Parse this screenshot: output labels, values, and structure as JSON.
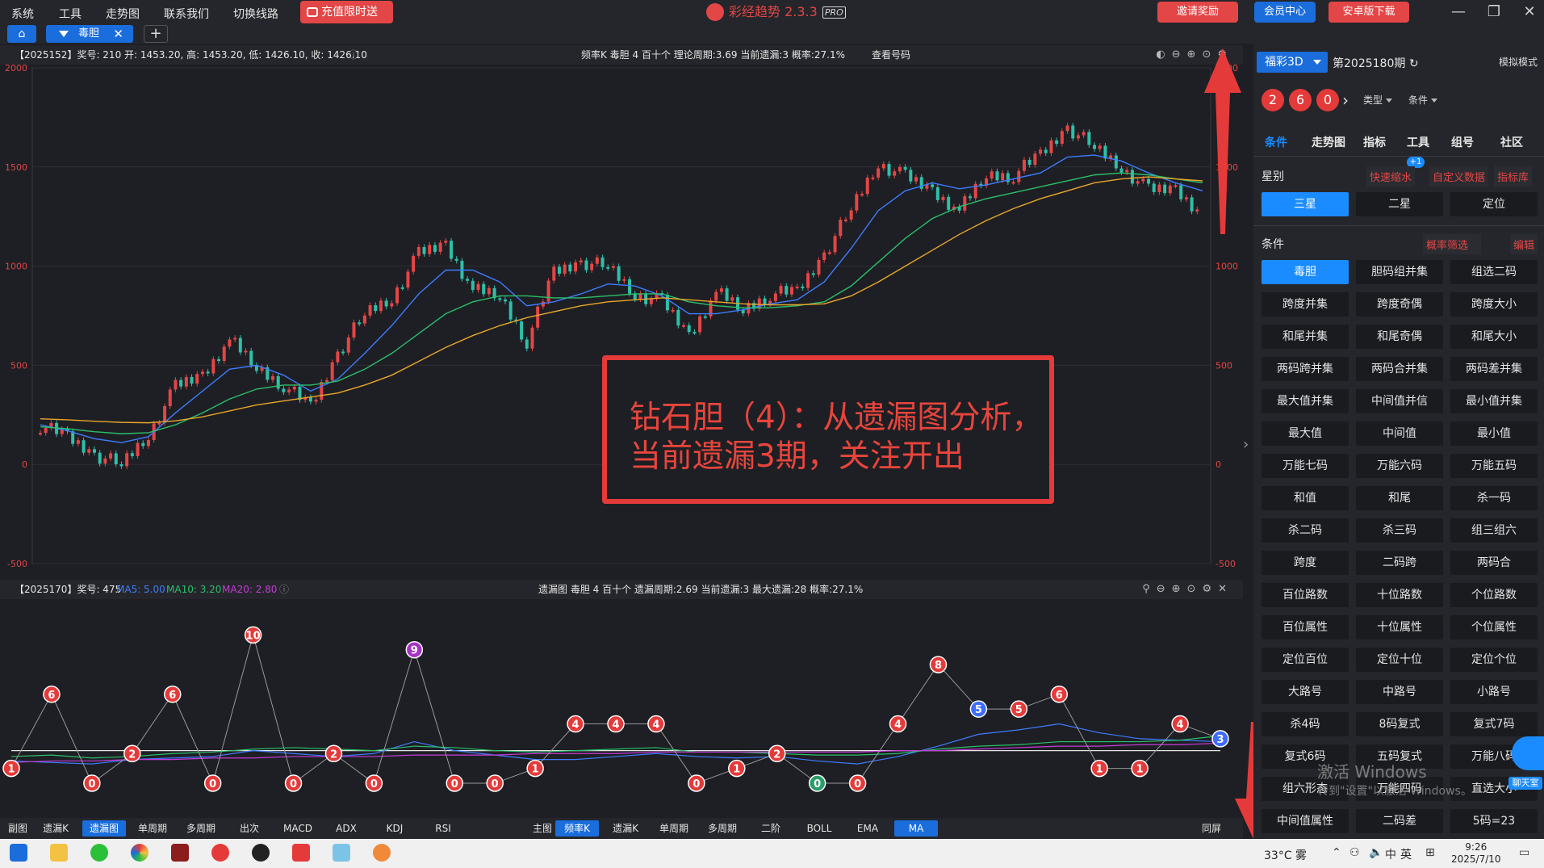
{
  "menu": {
    "items": [
      "系统",
      "工具",
      "走势图",
      "联系我们",
      "切换线路"
    ],
    "recharge": "充值限时送"
  },
  "app": {
    "name": "彩经趋势 2.3.3",
    "edition": "PRO"
  },
  "top": {
    "invite": "邀请奖励",
    "member": "会员中心",
    "android": "安卓版下载",
    "min": "—",
    "restore": "❐",
    "close": "✕"
  },
  "tabs": {
    "home": "⌂",
    "active": "毒胆",
    "close": "✕",
    "add": "+"
  },
  "kpanel": {
    "info": "【2025152】奖号: 210  开: 1453.20, 高: 1453.20, 低: 1426.10, 收: 1426.10",
    "center": "频率K  毒胆  4  百十个  理论周期:3.69  当前遗漏:3  概率:27.1%",
    "query": "查看号码",
    "yticks": [
      "2000",
      "1500",
      "1000",
      "500",
      "0",
      "-500"
    ]
  },
  "mpanel": {
    "info": "【2025170】奖号: 475",
    "ma5": "MA5: 5.00",
    "ma10": "MA10: 3.20",
    "ma20": "MA20: 2.80",
    "center": "遗漏图  毒胆  4  百十个  遗漏周期:2.69  当前遗漏:3  最大遗漏:28  概率:27.1%"
  },
  "chart_data": [
    {
      "type": "candlestick",
      "title": "",
      "yticks": [
        2000,
        1500,
        1000,
        500,
        0,
        -500
      ],
      "ylim": [
        -500,
        2000
      ],
      "series": [
        {
          "name": "close",
          "values": [
            195,
            140,
            50,
            0,
            150,
            390,
            450,
            630,
            490,
            400,
            290,
            560,
            760,
            840,
            1060,
            1110,
            880,
            850,
            620,
            970,
            1020,
            1000,
            860,
            820,
            650,
            870,
            780,
            860,
            870,
            1060,
            1290,
            1520,
            1450,
            1380,
            1280,
            1460,
            1460,
            1560,
            1700,
            1600,
            1500,
            1380,
            1390,
            1260
          ]
        },
        {
          "name": "ma_fast",
          "values": [
            200,
            170,
            130,
            110,
            140,
            260,
            370,
            480,
            500,
            450,
            370,
            430,
            560,
            700,
            860,
            980,
            980,
            920,
            800,
            820,
            860,
            910,
            900,
            850,
            760,
            760,
            780,
            810,
            830,
            920,
            1090,
            1280,
            1380,
            1420,
            1390,
            1410,
            1440,
            1470,
            1550,
            1560,
            1530,
            1470,
            1420,
            1380
          ]
        },
        {
          "name": "ma_mid",
          "values": [
            190,
            180,
            165,
            155,
            160,
            200,
            260,
            330,
            380,
            400,
            400,
            420,
            480,
            560,
            660,
            760,
            820,
            850,
            850,
            840,
            840,
            850,
            860,
            860,
            820,
            800,
            790,
            790,
            800,
            820,
            900,
            1020,
            1140,
            1240,
            1300,
            1340,
            1370,
            1400,
            1430,
            1460,
            1470,
            1460,
            1440,
            1420
          ]
        },
        {
          "name": "ma_slow",
          "values": [
            230,
            225,
            218,
            212,
            210,
            220,
            240,
            270,
            300,
            320,
            340,
            360,
            400,
            450,
            520,
            590,
            650,
            700,
            740,
            770,
            800,
            820,
            830,
            840,
            830,
            820,
            810,
            805,
            805,
            810,
            850,
            920,
            1000,
            1080,
            1160,
            1230,
            1290,
            1340,
            1380,
            1420,
            1440,
            1450,
            1440,
            1430
          ]
        }
      ]
    },
    {
      "type": "line",
      "title": "",
      "ylim": [
        0,
        11
      ],
      "series": [
        {
          "name": "",
          "values": [
            1,
            6,
            0,
            2,
            6,
            0,
            10,
            0,
            2,
            0,
            9,
            0,
            0,
            1,
            4,
            4,
            4,
            0,
            1,
            2,
            0,
            0,
            4,
            8,
            5,
            5,
            6,
            1,
            1,
            4,
            3
          ]
        }
      ],
      "value_labels": [
        "1",
        "6",
        "0",
        "2",
        "6",
        "0",
        "10",
        "0",
        "2",
        "0",
        "9",
        "0",
        "0",
        "1",
        "4",
        "4",
        "4",
        "0",
        "1",
        "2",
        "0",
        "0",
        "4",
        "8",
        "5",
        "5",
        "6",
        "1",
        "1",
        "4",
        "3"
      ]
    }
  ],
  "annotation": {
    "line1": "钻石胆（4）：从遗漏图分析，",
    "line2": "当前遗漏3期，关注开出"
  },
  "bottombar": {
    "sub_label": "副图",
    "sub": [
      "遗漏K",
      "遗漏图",
      "单周期",
      "多周期",
      "出次",
      "MACD",
      "ADX",
      "KDJ",
      "RSI"
    ],
    "main_label": "主图",
    "main": [
      "频率K",
      "遗漏K",
      "单周期",
      "多周期",
      "二阶",
      "BOLL",
      "EMA",
      "MA"
    ],
    "split": "同屏"
  },
  "right": {
    "lottery": "福彩3D",
    "period": "第2025180期",
    "refresh": "↻",
    "sim": "模拟模式",
    "balls": [
      "2",
      "6",
      "0"
    ],
    "arrow": "›",
    "type_sel": "类型",
    "cond_sel": "条件",
    "navtabs": [
      "条件",
      "走势图",
      "指标",
      "工具",
      "组号",
      "社区"
    ],
    "star_label": "星别",
    "badge": "+1",
    "fast": "快速缩水",
    "custom": "自定义数据",
    "lib": "指标库",
    "stars": [
      "三星",
      "二星",
      "定位"
    ],
    "cond_label": "条件",
    "filter": "概率筛选",
    "edit": "编辑",
    "conditions": [
      "毒胆",
      "胆码组并集",
      "组选二码",
      "跨度并集",
      "跨度奇偶",
      "跨度大小",
      "和尾并集",
      "和尾奇偶",
      "和尾大小",
      "两码跨并集",
      "两码合并集",
      "两码差并集",
      "最大值并集",
      "中间值并信",
      "最小值并集",
      "最大值",
      "中间值",
      "最小值",
      "万能七码",
      "万能六码",
      "万能五码",
      "和值",
      "和尾",
      "杀一码",
      "杀二码",
      "杀三码",
      "组三组六",
      "跨度",
      "二码跨",
      "两码合",
      "百位路数",
      "十位路数",
      "个位路数",
      "百位属性",
      "十位属性",
      "个位属性",
      "定位百位",
      "定位十位",
      "定位个位",
      "大路号",
      "中路号",
      "小路号",
      "杀4码",
      "8码复式",
      "复式7码",
      "复式6码",
      "五码复式",
      "万能八码",
      "组六形态",
      "万能四码",
      "直选大小",
      "中间值属性",
      "二码差",
      "5码=23"
    ]
  },
  "watermark": {
    "l1": "激活 Windows",
    "l2": "转到\"设置\"以激活 Windows。"
  },
  "chat": "聊天室",
  "taskbar": {
    "weather": "33°C 雾",
    "time": "9:26",
    "date": "2025/7/10",
    "ime": "英"
  }
}
